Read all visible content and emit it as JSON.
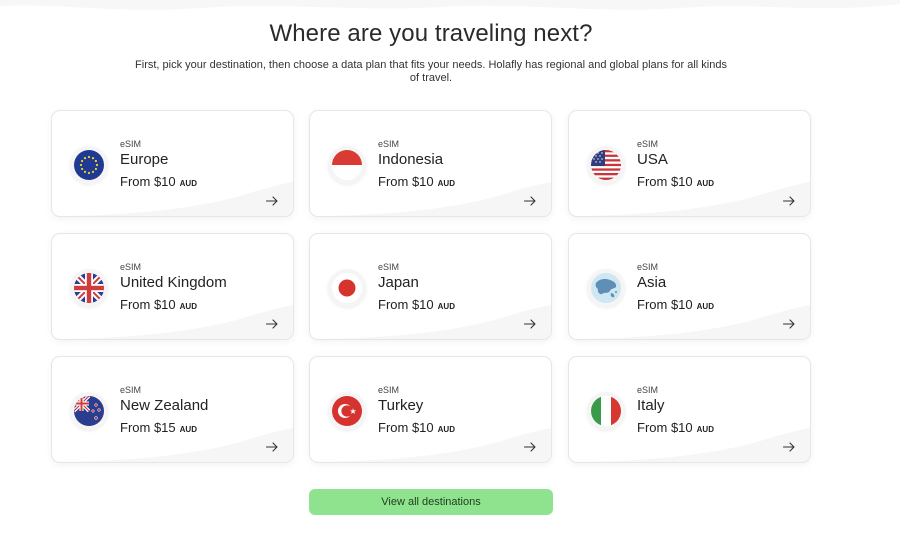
{
  "header": {
    "title": "Where are you traveling next?",
    "subtitle": "First, pick your destination, then choose a data plan that fits your needs. Holafly has regional and global plans for all kinds of travel."
  },
  "colors": {
    "cta_background": "#8fe38f",
    "card_border": "#e6e6e6",
    "text_primary": "#222222"
  },
  "destinations": [
    {
      "tag": "eSIM",
      "name": "Europe",
      "price_prefix": "From $10",
      "currency": "AUD",
      "flag_icon": "eu-flag-icon"
    },
    {
      "tag": "eSIM",
      "name": "Indonesia",
      "price_prefix": "From $10",
      "currency": "AUD",
      "flag_icon": "indonesia-flag-icon"
    },
    {
      "tag": "eSIM",
      "name": "USA",
      "price_prefix": "From $10",
      "currency": "AUD",
      "flag_icon": "usa-flag-icon"
    },
    {
      "tag": "eSIM",
      "name": "United Kingdom",
      "price_prefix": "From $10",
      "currency": "AUD",
      "flag_icon": "uk-flag-icon"
    },
    {
      "tag": "eSIM",
      "name": "Japan",
      "price_prefix": "From $10",
      "currency": "AUD",
      "flag_icon": "japan-flag-icon"
    },
    {
      "tag": "eSIM",
      "name": "Asia",
      "price_prefix": "From $10",
      "currency": "AUD",
      "flag_icon": "asia-map-icon"
    },
    {
      "tag": "eSIM",
      "name": "New Zealand",
      "price_prefix": "From $15",
      "currency": "AUD",
      "flag_icon": "new-zealand-flag-icon"
    },
    {
      "tag": "eSIM",
      "name": "Turkey",
      "price_prefix": "From $10",
      "currency": "AUD",
      "flag_icon": "turkey-flag-icon"
    },
    {
      "tag": "eSIM",
      "name": "Italy",
      "price_prefix": "From $10",
      "currency": "AUD",
      "flag_icon": "italy-flag-icon"
    }
  ],
  "cta": {
    "label": "View all destinations"
  }
}
